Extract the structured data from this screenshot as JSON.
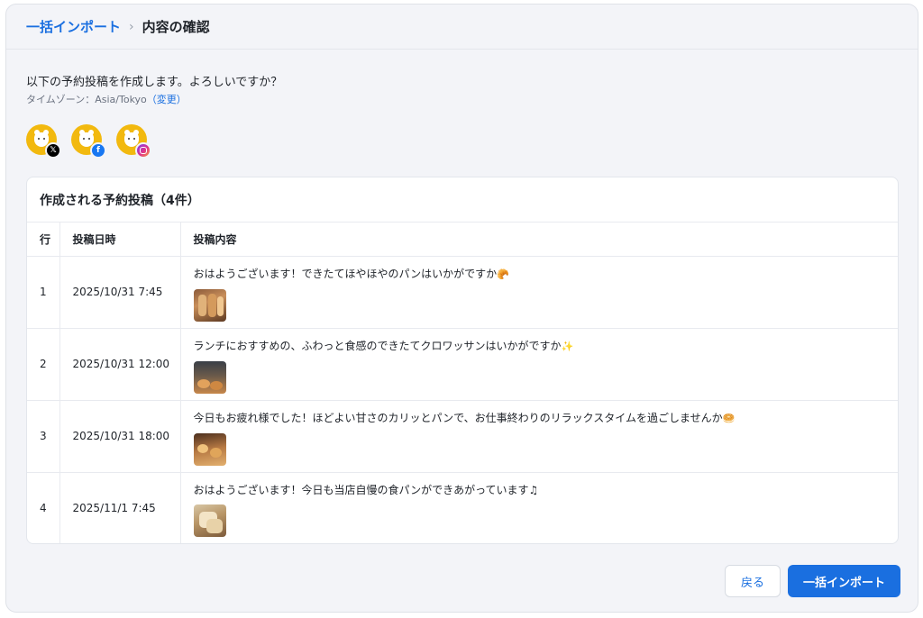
{
  "breadcrumb": {
    "parent": "一括インポート",
    "separator": "›",
    "current": "内容の確認"
  },
  "intro": {
    "message": "以下の予約投稿を作成します。よろしいですか？",
    "timezone_label": "タイムゾーン：Asia/Tokyo",
    "timezone_change": "（変更）"
  },
  "accounts": [
    {
      "network": "X",
      "badge_icon": "x-logo-icon",
      "badge_glyph": "𝕏"
    },
    {
      "network": "Facebook",
      "badge_icon": "facebook-logo-icon",
      "badge_glyph": "f"
    },
    {
      "network": "Instagram",
      "badge_icon": "instagram-logo-icon",
      "badge_glyph": ""
    }
  ],
  "table": {
    "title": "作成される予約投稿（4件）",
    "columns": [
      "行",
      "投稿日時",
      "投稿内容"
    ],
    "rows": [
      {
        "row": "1",
        "datetime": "2025/10/31 7:45",
        "text": "おはようございます！できたてほやほやのパンはいかがですか",
        "emoji": "🥐"
      },
      {
        "row": "2",
        "datetime": "2025/10/31 12:00",
        "text": "ランチにおすすめの、ふわっと食感のできたてクロワッサンはいかがですか",
        "emoji": "✨"
      },
      {
        "row": "3",
        "datetime": "2025/10/31 18:00",
        "text": "今日もお疲れ様でした！ほどよい甘さのカリッとパンで、お仕事終わりのリラックスタイムを過ごしませんか",
        "emoji": "🥯"
      },
      {
        "row": "4",
        "datetime": "2025/11/1 7:45",
        "text": "おはようございます！今日も当店自慢の食パンができあがっています♫",
        "emoji": ""
      }
    ]
  },
  "buttons": {
    "back": "戻る",
    "import": "一括インポート"
  },
  "colors": {
    "accent": "#1a6fe0",
    "avatar": "#f2b90f",
    "background": "#f3f4f8"
  }
}
